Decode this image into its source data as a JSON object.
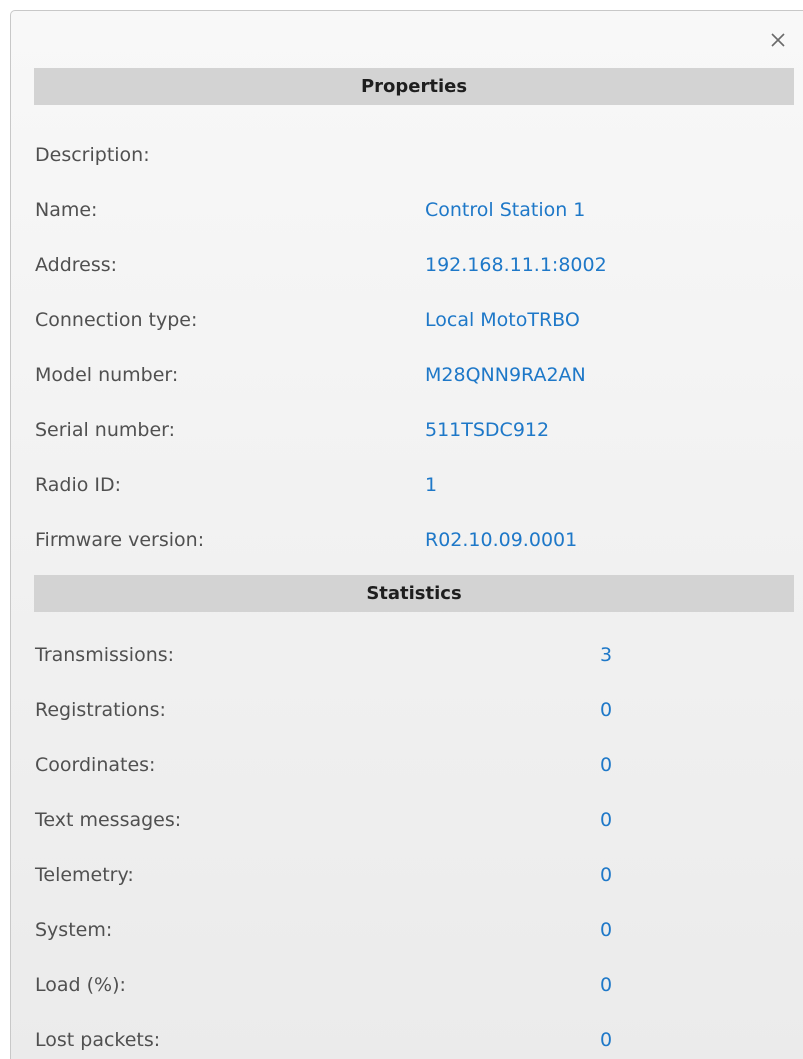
{
  "close": {
    "icon": "close-icon"
  },
  "properties": {
    "header": "Properties",
    "description_label": "Description:",
    "description_value": "",
    "rows": [
      {
        "label": "Name:",
        "value": "Control Station 1"
      },
      {
        "label": "Address:",
        "value": "192.168.11.1:8002"
      },
      {
        "label": "Connection type:",
        "value": "Local MotoTRBO"
      },
      {
        "label": "Model number:",
        "value": "M28QNN9RA2AN"
      },
      {
        "label": "Serial number:",
        "value": "511TSDC912"
      },
      {
        "label": "Radio ID:",
        "value": "1"
      },
      {
        "label": "Firmware version:",
        "value": "R02.10.09.0001"
      }
    ]
  },
  "statistics": {
    "header": "Statistics",
    "rows": [
      {
        "label": "Transmissions:",
        "value": "3"
      },
      {
        "label": "Registrations:",
        "value": "0"
      },
      {
        "label": "Coordinates:",
        "value": "0"
      },
      {
        "label": "Text messages:",
        "value": "0"
      },
      {
        "label": "Telemetry:",
        "value": "0"
      },
      {
        "label": "System:",
        "value": "0"
      },
      {
        "label": "Load (%):",
        "value": "0"
      },
      {
        "label": "Lost packets:",
        "value": "0"
      }
    ]
  },
  "colors": {
    "value_text": "#1e78c8",
    "label_text": "#505050",
    "header_bg": "#d3d3d3"
  }
}
